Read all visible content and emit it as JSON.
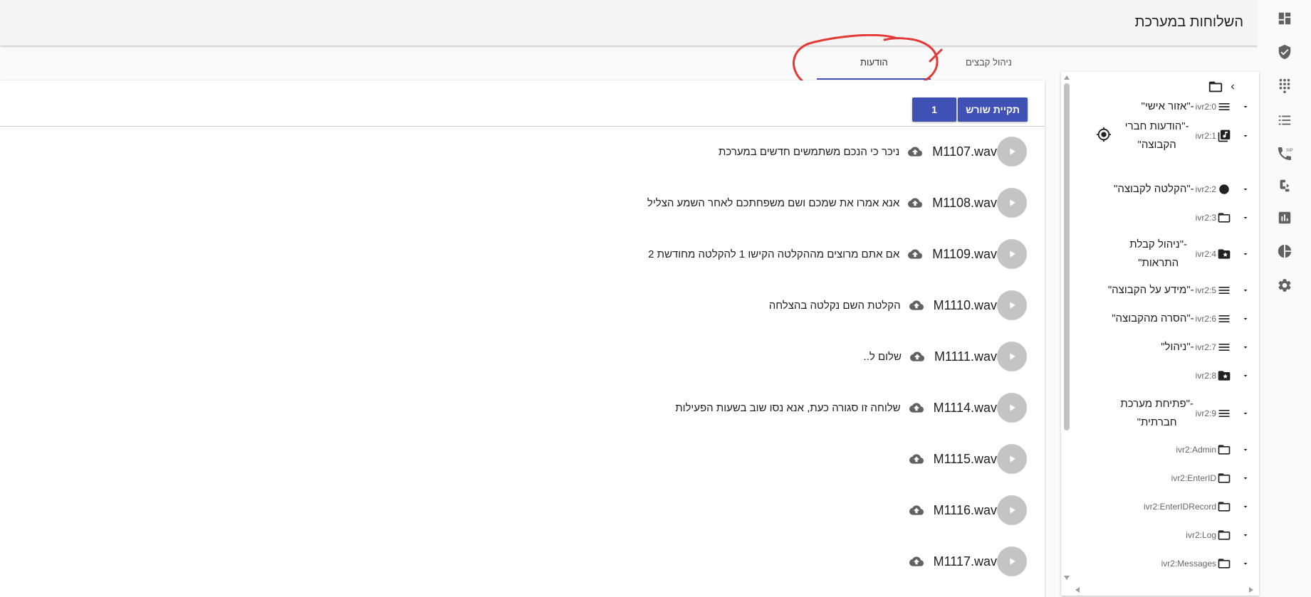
{
  "header": {
    "title": "השלוחות במערכת"
  },
  "rail": {
    "icons": [
      "dashboard-icon",
      "verified-shield-icon",
      "dialpad-icon",
      "list-icon",
      "sip-phone-icon",
      "phone-forward-icon",
      "bar-chart-icon",
      "pie-chart-icon",
      "settings-icon"
    ]
  },
  "tabs": [
    {
      "label": "ניהול קבצים",
      "active": false
    },
    {
      "label": "הודעות",
      "active": true
    }
  ],
  "tree": {
    "nodes": [
      {
        "code": "ivr2:0",
        "name": "-\"אזור אישי\"",
        "icon": "menu-lines-icon"
      },
      {
        "code": "ivr2:1",
        "name": "-\"הודעות חברי הקבוצה\"",
        "icon": "music-library-icon"
      },
      {
        "code": "ivr2:2",
        "name": "-\"הקלטה לקבוצה\"",
        "icon": "record-dot-icon"
      },
      {
        "code": "ivr2:3",
        "name": "",
        "icon": "folder-icon"
      },
      {
        "code": "ivr2:4",
        "name": "-\"ניהול קבלת התראות\"",
        "icon": "star-folder-icon"
      },
      {
        "code": "ivr2:5",
        "name": "-\"מידע על הקבוצה\"",
        "icon": "menu-lines-icon"
      },
      {
        "code": "ivr2:6",
        "name": "-\"הסרה מהקבוצה\"",
        "icon": "menu-lines-icon"
      },
      {
        "code": "ivr2:7",
        "name": "-\"ניהול\"",
        "icon": "menu-lines-icon"
      },
      {
        "code": "ivr2:8",
        "name": "",
        "icon": "star-folder-icon"
      },
      {
        "code": "ivr2:9",
        "name": "-\"פתיחת מערכת חברתית\"",
        "icon": "menu-lines-icon"
      },
      {
        "code": "ivr2:Admin",
        "name": "",
        "icon": "folder-icon"
      },
      {
        "code": "ivr2:EnterID",
        "name": "",
        "icon": "folder-icon"
      },
      {
        "code": "ivr2:EnterIDRecord",
        "name": "",
        "icon": "folder-icon"
      },
      {
        "code": "ivr2:Log",
        "name": "",
        "icon": "folder-icon"
      },
      {
        "code": "ivr2:Messages",
        "name": "",
        "icon": "folder-icon"
      }
    ]
  },
  "toolbar": {
    "root_button": "תקיית שורש",
    "level_button": "1"
  },
  "files": [
    {
      "name": "M1107.wav",
      "description": "ניכר כי הנכם משתמשים חדשים במערכת"
    },
    {
      "name": "M1108.wav",
      "description": "אנא אמרו את שמכם ושם משפחתכם לאחר השמע הצליל"
    },
    {
      "name": "M1109.wav",
      "description": "אם אתם מרוצים מההקלטה הקישו 1 להקלטה מחודשת 2"
    },
    {
      "name": "M1110.wav",
      "description": "הקלטת השם נקלטה בהצלחה"
    },
    {
      "name": "M1111.wav",
      "description": "שלום ל.."
    },
    {
      "name": "M1114.wav",
      "description": "שלוחה זו סגורה כעת, אנא נסו שוב בשעות הפעילות"
    },
    {
      "name": "M1115.wav",
      "description": ""
    },
    {
      "name": "M1116.wav",
      "description": ""
    },
    {
      "name": "M1117.wav",
      "description": ""
    }
  ],
  "colors": {
    "primary": "#3f51b5",
    "annotation": "#e53935",
    "play_button": "#c4c4c4"
  }
}
